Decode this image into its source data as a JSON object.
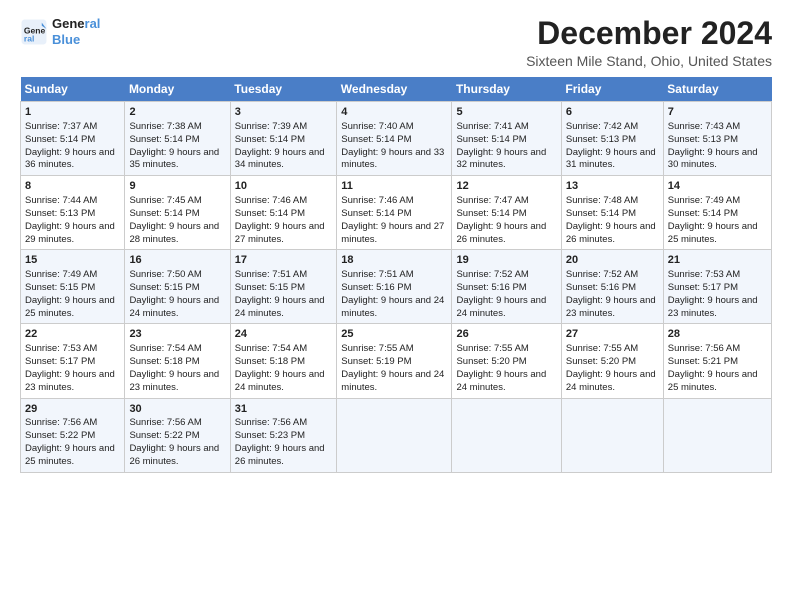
{
  "logo": {
    "line1": "General",
    "line2": "Blue"
  },
  "title": "December 2024",
  "subtitle": "Sixteen Mile Stand, Ohio, United States",
  "header": {
    "colors": {
      "accent": "#4a7ec7"
    }
  },
  "days_of_week": [
    "Sunday",
    "Monday",
    "Tuesday",
    "Wednesday",
    "Thursday",
    "Friday",
    "Saturday"
  ],
  "weeks": [
    {
      "cells": [
        {
          "day": "1",
          "sunrise": "Sunrise: 7:37 AM",
          "sunset": "Sunset: 5:14 PM",
          "daylight": "Daylight: 9 hours and 36 minutes."
        },
        {
          "day": "2",
          "sunrise": "Sunrise: 7:38 AM",
          "sunset": "Sunset: 5:14 PM",
          "daylight": "Daylight: 9 hours and 35 minutes."
        },
        {
          "day": "3",
          "sunrise": "Sunrise: 7:39 AM",
          "sunset": "Sunset: 5:14 PM",
          "daylight": "Daylight: 9 hours and 34 minutes."
        },
        {
          "day": "4",
          "sunrise": "Sunrise: 7:40 AM",
          "sunset": "Sunset: 5:14 PM",
          "daylight": "Daylight: 9 hours and 33 minutes."
        },
        {
          "day": "5",
          "sunrise": "Sunrise: 7:41 AM",
          "sunset": "Sunset: 5:14 PM",
          "daylight": "Daylight: 9 hours and 32 minutes."
        },
        {
          "day": "6",
          "sunrise": "Sunrise: 7:42 AM",
          "sunset": "Sunset: 5:13 PM",
          "daylight": "Daylight: 9 hours and 31 minutes."
        },
        {
          "day": "7",
          "sunrise": "Sunrise: 7:43 AM",
          "sunset": "Sunset: 5:13 PM",
          "daylight": "Daylight: 9 hours and 30 minutes."
        }
      ]
    },
    {
      "cells": [
        {
          "day": "8",
          "sunrise": "Sunrise: 7:44 AM",
          "sunset": "Sunset: 5:13 PM",
          "daylight": "Daylight: 9 hours and 29 minutes."
        },
        {
          "day": "9",
          "sunrise": "Sunrise: 7:45 AM",
          "sunset": "Sunset: 5:14 PM",
          "daylight": "Daylight: 9 hours and 28 minutes."
        },
        {
          "day": "10",
          "sunrise": "Sunrise: 7:46 AM",
          "sunset": "Sunset: 5:14 PM",
          "daylight": "Daylight: 9 hours and 27 minutes."
        },
        {
          "day": "11",
          "sunrise": "Sunrise: 7:46 AM",
          "sunset": "Sunset: 5:14 PM",
          "daylight": "Daylight: 9 hours and 27 minutes."
        },
        {
          "day": "12",
          "sunrise": "Sunrise: 7:47 AM",
          "sunset": "Sunset: 5:14 PM",
          "daylight": "Daylight: 9 hours and 26 minutes."
        },
        {
          "day": "13",
          "sunrise": "Sunrise: 7:48 AM",
          "sunset": "Sunset: 5:14 PM",
          "daylight": "Daylight: 9 hours and 26 minutes."
        },
        {
          "day": "14",
          "sunrise": "Sunrise: 7:49 AM",
          "sunset": "Sunset: 5:14 PM",
          "daylight": "Daylight: 9 hours and 25 minutes."
        }
      ]
    },
    {
      "cells": [
        {
          "day": "15",
          "sunrise": "Sunrise: 7:49 AM",
          "sunset": "Sunset: 5:15 PM",
          "daylight": "Daylight: 9 hours and 25 minutes."
        },
        {
          "day": "16",
          "sunrise": "Sunrise: 7:50 AM",
          "sunset": "Sunset: 5:15 PM",
          "daylight": "Daylight: 9 hours and 24 minutes."
        },
        {
          "day": "17",
          "sunrise": "Sunrise: 7:51 AM",
          "sunset": "Sunset: 5:15 PM",
          "daylight": "Daylight: 9 hours and 24 minutes."
        },
        {
          "day": "18",
          "sunrise": "Sunrise: 7:51 AM",
          "sunset": "Sunset: 5:16 PM",
          "daylight": "Daylight: 9 hours and 24 minutes."
        },
        {
          "day": "19",
          "sunrise": "Sunrise: 7:52 AM",
          "sunset": "Sunset: 5:16 PM",
          "daylight": "Daylight: 9 hours and 24 minutes."
        },
        {
          "day": "20",
          "sunrise": "Sunrise: 7:52 AM",
          "sunset": "Sunset: 5:16 PM",
          "daylight": "Daylight: 9 hours and 23 minutes."
        },
        {
          "day": "21",
          "sunrise": "Sunrise: 7:53 AM",
          "sunset": "Sunset: 5:17 PM",
          "daylight": "Daylight: 9 hours and 23 minutes."
        }
      ]
    },
    {
      "cells": [
        {
          "day": "22",
          "sunrise": "Sunrise: 7:53 AM",
          "sunset": "Sunset: 5:17 PM",
          "daylight": "Daylight: 9 hours and 23 minutes."
        },
        {
          "day": "23",
          "sunrise": "Sunrise: 7:54 AM",
          "sunset": "Sunset: 5:18 PM",
          "daylight": "Daylight: 9 hours and 23 minutes."
        },
        {
          "day": "24",
          "sunrise": "Sunrise: 7:54 AM",
          "sunset": "Sunset: 5:18 PM",
          "daylight": "Daylight: 9 hours and 24 minutes."
        },
        {
          "day": "25",
          "sunrise": "Sunrise: 7:55 AM",
          "sunset": "Sunset: 5:19 PM",
          "daylight": "Daylight: 9 hours and 24 minutes."
        },
        {
          "day": "26",
          "sunrise": "Sunrise: 7:55 AM",
          "sunset": "Sunset: 5:20 PM",
          "daylight": "Daylight: 9 hours and 24 minutes."
        },
        {
          "day": "27",
          "sunrise": "Sunrise: 7:55 AM",
          "sunset": "Sunset: 5:20 PM",
          "daylight": "Daylight: 9 hours and 24 minutes."
        },
        {
          "day": "28",
          "sunrise": "Sunrise: 7:56 AM",
          "sunset": "Sunset: 5:21 PM",
          "daylight": "Daylight: 9 hours and 25 minutes."
        }
      ]
    },
    {
      "cells": [
        {
          "day": "29",
          "sunrise": "Sunrise: 7:56 AM",
          "sunset": "Sunset: 5:22 PM",
          "daylight": "Daylight: 9 hours and 25 minutes."
        },
        {
          "day": "30",
          "sunrise": "Sunrise: 7:56 AM",
          "sunset": "Sunset: 5:22 PM",
          "daylight": "Daylight: 9 hours and 26 minutes."
        },
        {
          "day": "31",
          "sunrise": "Sunrise: 7:56 AM",
          "sunset": "Sunset: 5:23 PM",
          "daylight": "Daylight: 9 hours and 26 minutes."
        },
        null,
        null,
        null,
        null
      ]
    }
  ]
}
